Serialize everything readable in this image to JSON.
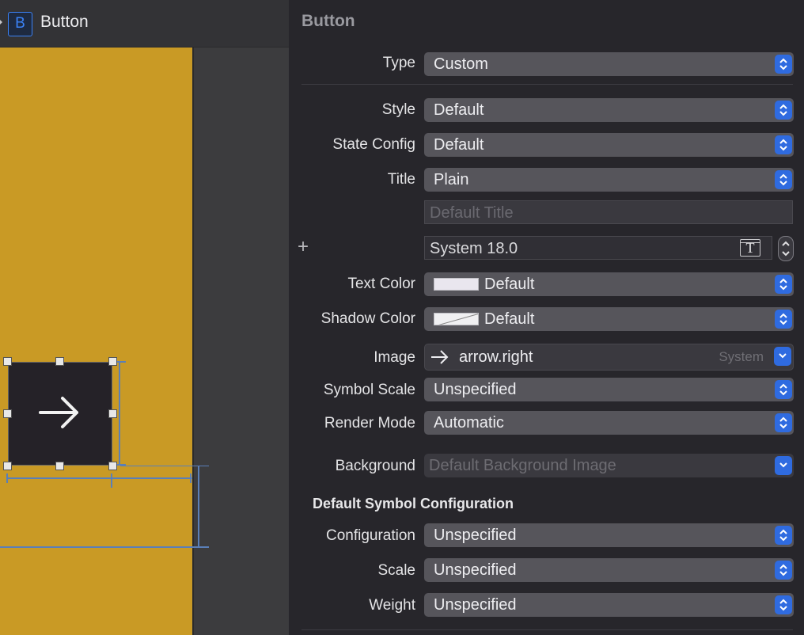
{
  "document": {
    "badge_letter": "B",
    "title": "Button"
  },
  "inspector": {
    "title": "Button",
    "type": {
      "label": "Type",
      "value": "Custom"
    },
    "style": {
      "label": "Style",
      "value": "Default"
    },
    "state_config": {
      "label": "State Config",
      "value": "Default"
    },
    "title_row": {
      "label": "Title",
      "value": "Plain"
    },
    "title_field": {
      "placeholder": "Default Title"
    },
    "font": {
      "value": "System 18.0",
      "plus": "+"
    },
    "text_color": {
      "label": "Text Color",
      "value": "Default"
    },
    "shadow_color": {
      "label": "Shadow Color",
      "value": "Default"
    },
    "image": {
      "label": "Image",
      "value": "arrow.right",
      "tag": "System"
    },
    "symbol_scale": {
      "label": "Symbol Scale",
      "value": "Unspecified"
    },
    "render_mode": {
      "label": "Render Mode",
      "value": "Automatic"
    },
    "background": {
      "label": "Background",
      "placeholder": "Default Background Image"
    },
    "section_title": "Default Symbol Configuration",
    "configuration": {
      "label": "Configuration",
      "value": "Unspecified"
    },
    "scale": {
      "label": "Scale",
      "value": "Unspecified"
    },
    "weight": {
      "label": "Weight",
      "value": "Unspecified"
    }
  },
  "colors": {
    "artboard": "#c99a25",
    "accent": "#2f6be0",
    "inspector_bg": "#27262b"
  },
  "icons": [
    "chevron-right-icon",
    "button-badge-icon",
    "arrow-right-icon",
    "up-down-stepper-icon",
    "font-picker-icon",
    "plus-icon",
    "chevron-down-icon"
  ]
}
